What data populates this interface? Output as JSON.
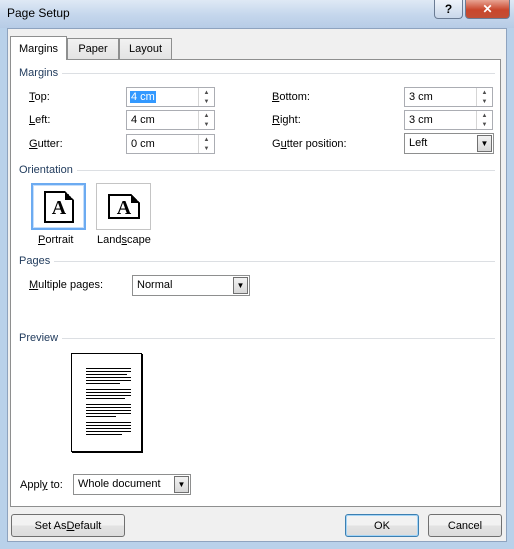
{
  "window": {
    "title": "Page Setup",
    "help_glyph": "?",
    "close_glyph": "✕"
  },
  "tabs": [
    {
      "label": "Margins",
      "active": true
    },
    {
      "label": "Paper",
      "active": false
    },
    {
      "label": "Layout",
      "active": false
    }
  ],
  "margins": {
    "heading": "Margins",
    "top": {
      "mnemonic": "T",
      "rest": "op:",
      "value": "4 cm"
    },
    "left": {
      "mnemonic": "L",
      "rest": "eft:",
      "value": "4 cm"
    },
    "gutter": {
      "mnemonic": "G",
      "rest": "utter:",
      "value": "0 cm"
    },
    "bottom": {
      "mnemonic": "B",
      "rest": "ottom:",
      "value": "3 cm"
    },
    "right": {
      "mnemonic": "R",
      "rest": "ight:",
      "value": "3 cm"
    },
    "gutter_position": {
      "pre": "G",
      "mnemonic": "u",
      "rest": "tter position:",
      "value": "Left"
    }
  },
  "orientation": {
    "heading": "Orientation",
    "portrait": {
      "mnemonic": "P",
      "rest": "ortrait",
      "glyph": "A",
      "selected": true
    },
    "landscape": {
      "pre": "Land",
      "mnemonic": "s",
      "rest": "cape",
      "glyph": "A",
      "selected": false
    }
  },
  "pages": {
    "heading": "Pages",
    "multiple_pages": {
      "mnemonic": "M",
      "rest": "ultiple pages:",
      "value": "Normal"
    }
  },
  "preview": {
    "heading": "Preview",
    "apply_to": {
      "pre": "Appl",
      "mnemonic": "y",
      "rest": " to:",
      "value": "Whole document"
    }
  },
  "buttons": {
    "set_as_default": {
      "pre": "Set As ",
      "mnemonic": "D",
      "rest": "efault"
    },
    "ok": "OK",
    "cancel": "Cancel"
  },
  "colors": {
    "group_heading": "#1e395b",
    "selection": "#3399ff",
    "close_button": "#c9462c"
  }
}
